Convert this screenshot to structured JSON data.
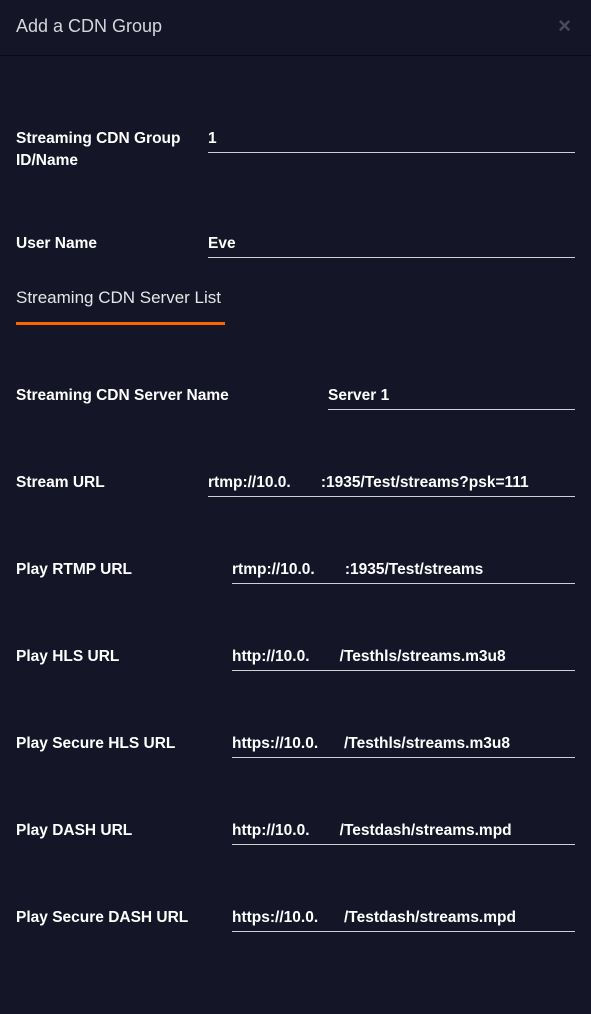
{
  "header": {
    "title": "Add a CDN Group",
    "close_icon": "×"
  },
  "fields": {
    "group_id_name": {
      "label": "Streaming CDN Group ID/Name",
      "value": "1"
    },
    "user_name": {
      "label": "User Name",
      "value": "Eve"
    }
  },
  "section": {
    "tab_label": "Streaming CDN Server List"
  },
  "server": {
    "server_name": {
      "label": "Streaming CDN Server Name",
      "value": "Server 1"
    },
    "stream_url": {
      "label": "Stream URL",
      "value": "rtmp://10.0.       :1935/Test/streams?psk=111"
    },
    "play_rtmp_url": {
      "label": "Play RTMP URL",
      "value": "rtmp://10.0.       :1935/Test/streams"
    },
    "play_hls_url": {
      "label": "Play HLS URL",
      "value": "http://10.0.       /Testhls/streams.m3u8"
    },
    "play_secure_hls_url": {
      "label": "Play Secure HLS URL",
      "value": "https://10.0.      /Testhls/streams.m3u8"
    },
    "play_dash_url": {
      "label": "Play DASH URL",
      "value": "http://10.0.       /Testdash/streams.mpd"
    },
    "play_secure_dash_url": {
      "label": "Play Secure DASH URL",
      "value": "https://10.0.      /Testdash/streams.mpd"
    }
  }
}
